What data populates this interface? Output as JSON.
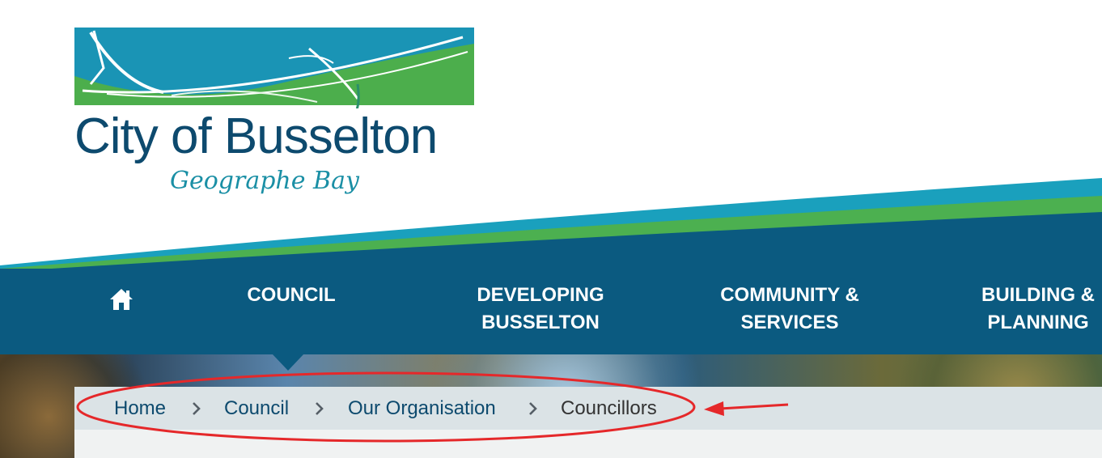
{
  "logo": {
    "name": "City of Busselton",
    "tagline": "Geographe Bay"
  },
  "nav": {
    "home_label": "Home",
    "items": [
      {
        "label": "COUNCIL",
        "active": true
      },
      {
        "label": "DEVELOPING\nBUSSELTON"
      },
      {
        "label": "COMMUNITY &\nSERVICES"
      },
      {
        "label": "BUILDING &\nPLANNING"
      }
    ]
  },
  "breadcrumb": {
    "items": [
      "Home",
      "Council",
      "Our Organisation"
    ],
    "current": "Councillors"
  },
  "colors": {
    "nav_bg": "#0b5a80",
    "teal": "#1aa0bd",
    "green": "#4cb050",
    "breadcrumb_bg": "#dbe3e6",
    "annotation": "#e5282a"
  },
  "icons": {
    "home": "home-icon",
    "separator": "chevron-right-icon",
    "annotation": "red-ellipse-and-arrow"
  }
}
